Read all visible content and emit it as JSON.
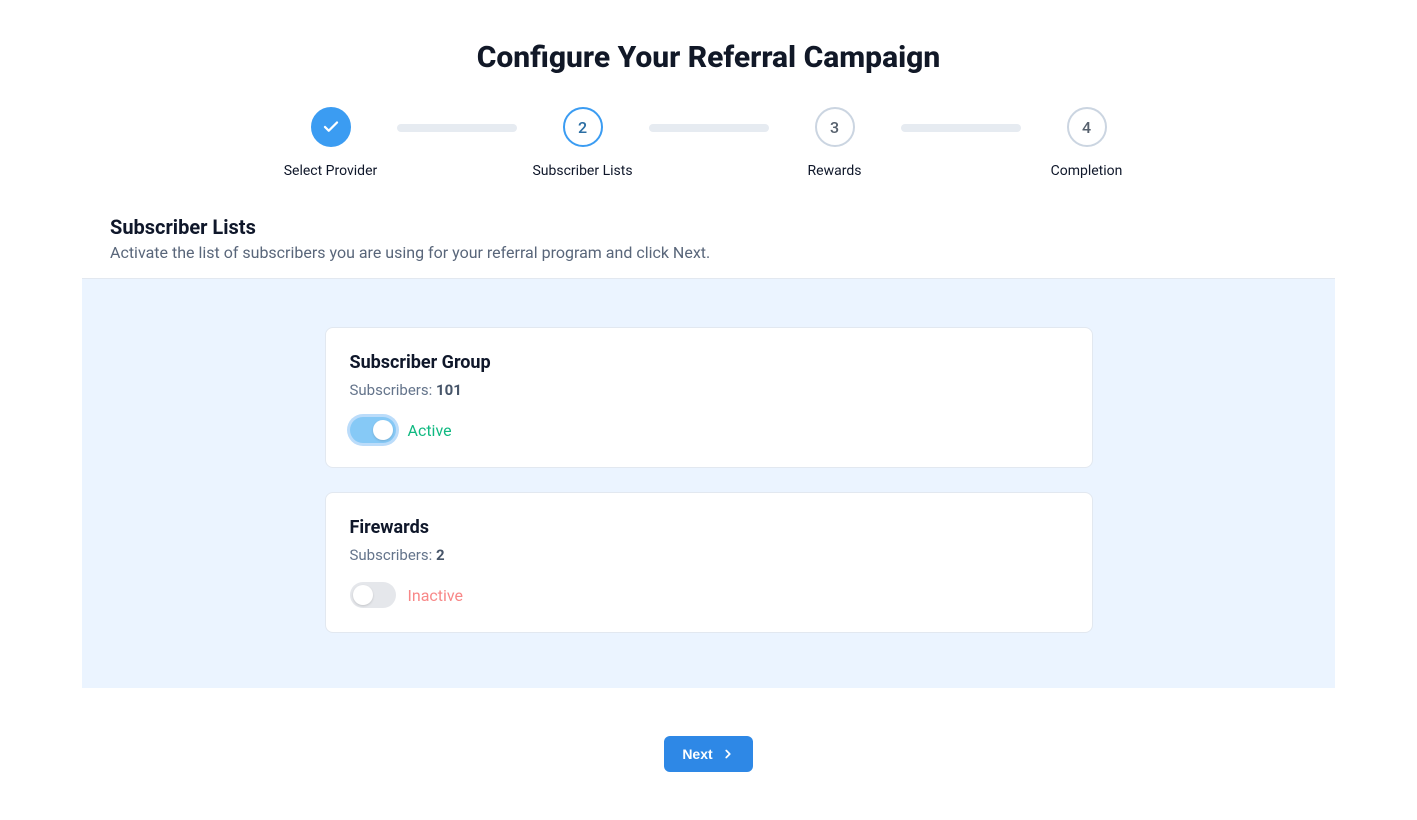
{
  "header": {
    "title": "Configure Your Referral Campaign"
  },
  "stepper": {
    "steps": [
      {
        "label": "Select Provider",
        "state": "completed",
        "display": ""
      },
      {
        "label": "Subscriber Lists",
        "state": "current",
        "display": "2"
      },
      {
        "label": "Rewards",
        "state": "upcoming",
        "display": "3"
      },
      {
        "label": "Completion",
        "state": "upcoming",
        "display": "4"
      }
    ]
  },
  "section": {
    "title": "Subscriber Lists",
    "description": "Activate the list of subscribers you are using for your referral program and click Next."
  },
  "labels": {
    "subscribers_prefix": "Subscribers: ",
    "active": "Active",
    "inactive": "Inactive",
    "next": "Next"
  },
  "lists": [
    {
      "name": "Subscriber Group",
      "count": "101",
      "active": true
    },
    {
      "name": "Firewards",
      "count": "2",
      "active": false
    }
  ]
}
